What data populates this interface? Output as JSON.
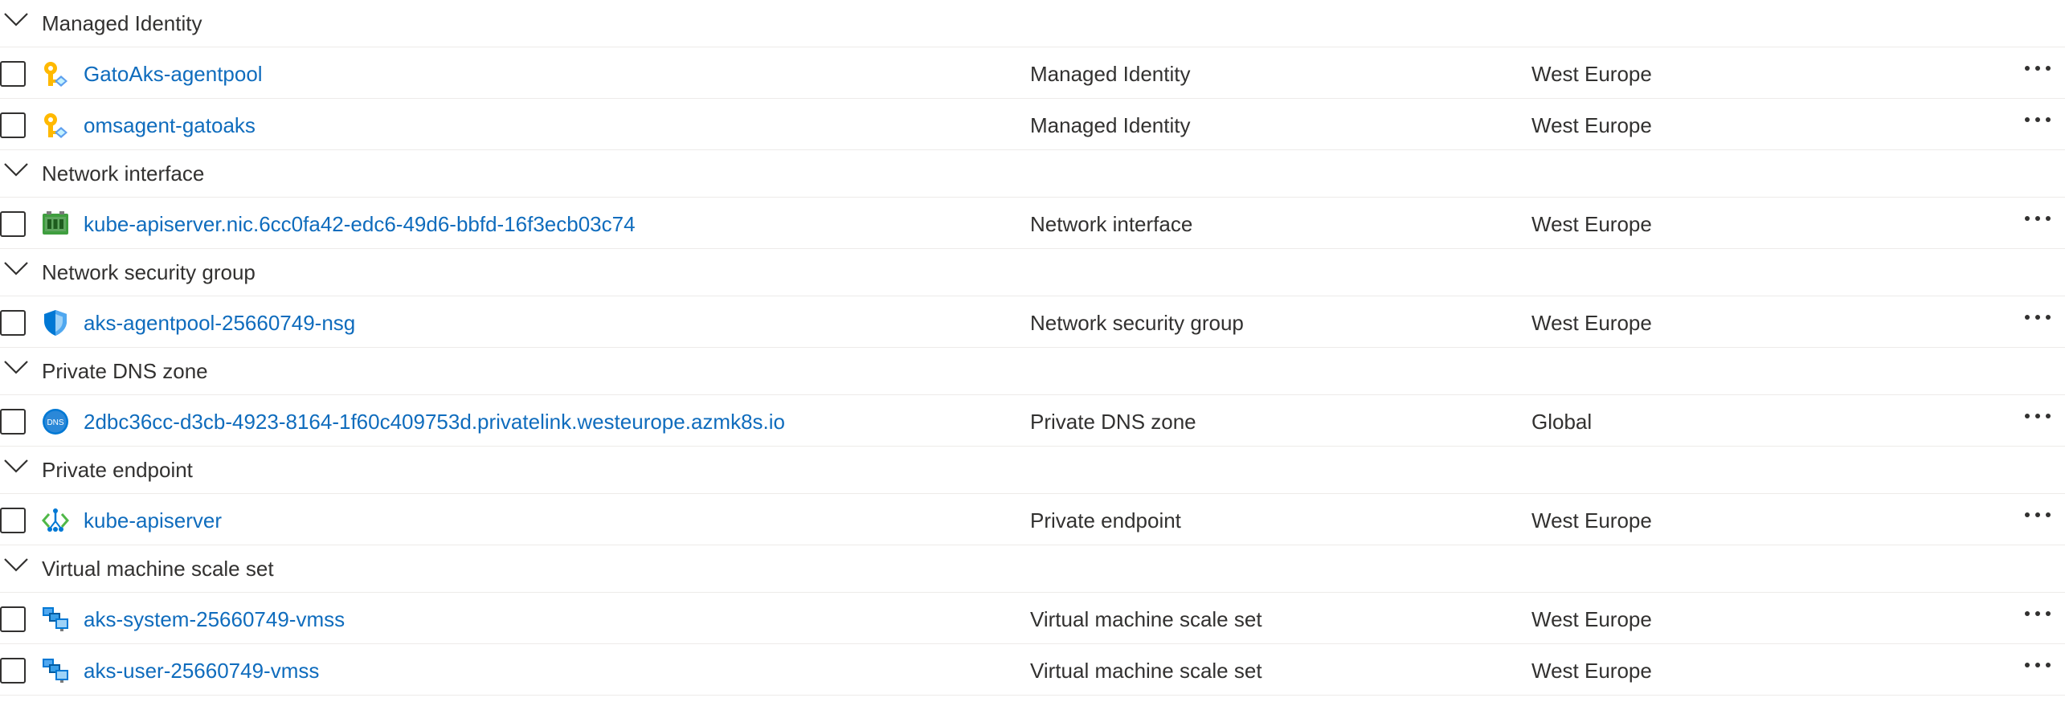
{
  "groups": [
    {
      "title": "Managed Identity",
      "items": [
        {
          "name": "GatoAks-agentpool",
          "type": "Managed Identity",
          "location": "West Europe",
          "icon": "managed-identity-icon"
        },
        {
          "name": "omsagent-gatoaks",
          "type": "Managed Identity",
          "location": "West Europe",
          "icon": "managed-identity-icon"
        }
      ]
    },
    {
      "title": "Network interface",
      "items": [
        {
          "name": "kube-apiserver.nic.6cc0fa42-edc6-49d6-bbfd-16f3ecb03c74",
          "type": "Network interface",
          "location": "West Europe",
          "icon": "network-interface-icon"
        }
      ]
    },
    {
      "title": "Network security group",
      "items": [
        {
          "name": "aks-agentpool-25660749-nsg",
          "type": "Network security group",
          "location": "West Europe",
          "icon": "network-security-group-icon"
        }
      ]
    },
    {
      "title": "Private DNS zone",
      "items": [
        {
          "name": "2dbc36cc-d3cb-4923-8164-1f60c409753d.privatelink.westeurope.azmk8s.io",
          "type": "Private DNS zone",
          "location": "Global",
          "icon": "dns-zone-icon"
        }
      ]
    },
    {
      "title": "Private endpoint",
      "items": [
        {
          "name": "kube-apiserver",
          "type": "Private endpoint",
          "location": "West Europe",
          "icon": "private-endpoint-icon"
        }
      ]
    },
    {
      "title": "Virtual machine scale set",
      "items": [
        {
          "name": "aks-system-25660749-vmss",
          "type": "Virtual machine scale set",
          "location": "West Europe",
          "icon": "vmss-icon"
        },
        {
          "name": "aks-user-25660749-vmss",
          "type": "Virtual machine scale set",
          "location": "West Europe",
          "icon": "vmss-icon"
        }
      ]
    }
  ],
  "dns_icon_text": "DNS",
  "colors": {
    "link": "#0f6cbd",
    "text": "#323130",
    "divider": "#edebe9"
  }
}
